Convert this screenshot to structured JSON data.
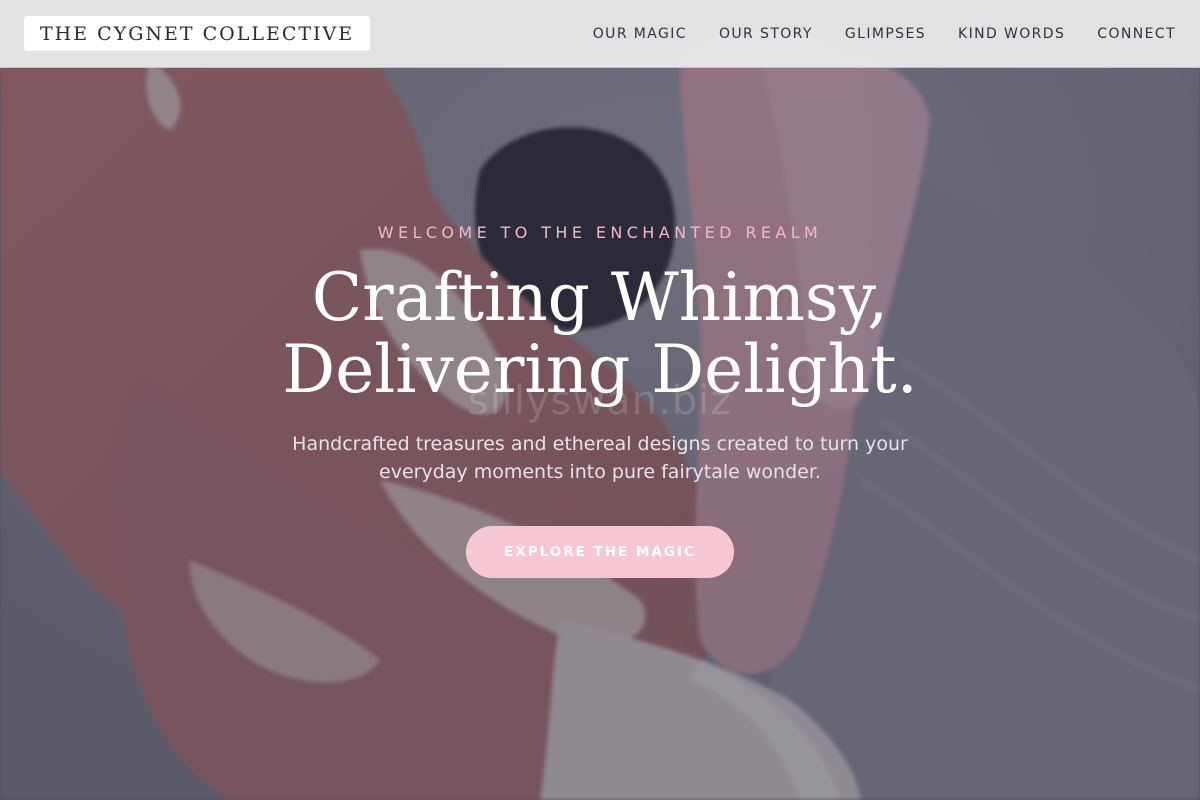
{
  "header": {
    "brand": "THE CYGNET COLLECTIVE",
    "nav": [
      {
        "label": "OUR MAGIC"
      },
      {
        "label": "OUR STORY"
      },
      {
        "label": "GLIMPSES"
      },
      {
        "label": "KIND WORDS"
      },
      {
        "label": "CONNECT"
      }
    ]
  },
  "hero": {
    "eyebrow": "WELCOME TO THE ENCHANTED REALM",
    "headline_line1": "Crafting Whimsy,",
    "headline_line2": "Delivering Delight.",
    "watermark": "sillyswan.biz",
    "subtext": "Handcrafted treasures and ethereal designs created to turn your everyday moments into pure fairytale wonder.",
    "cta_label": "EXPLORE THE MAGIC",
    "background_description_icon": "pottery-hands-image"
  },
  "colors": {
    "accent_pink": "#f7c6d3",
    "eyebrow_pink": "#f4b8c8",
    "header_bg": "#ececee",
    "text_dark": "#33333b"
  }
}
